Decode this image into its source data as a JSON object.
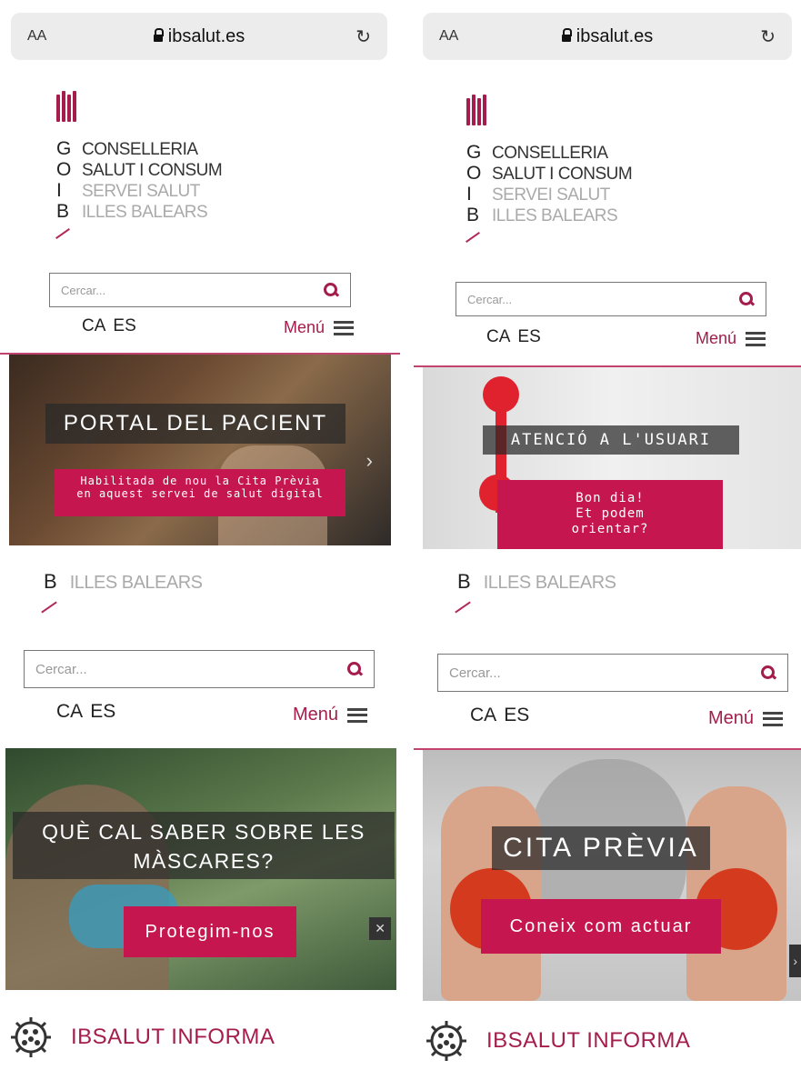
{
  "browser": {
    "aa_label": "AA",
    "host": "ibsalut.es",
    "reload_icon": "reload-icon"
  },
  "logo": {
    "letters": [
      "G",
      "O",
      "I",
      "B"
    ],
    "lines": [
      "CONSELLERIA",
      "SALUT I CONSUM",
      "SERVEI SALUT",
      "ILLES BALEARS"
    ],
    "accent": "#a41d4c"
  },
  "search": {
    "placeholder": "Cercar..."
  },
  "lang": {
    "ca": "CA",
    "es": "ES"
  },
  "menu": {
    "label": "Menú"
  },
  "partial_logo": {
    "letter": "B",
    "text": "ILLES BALEARS"
  },
  "slides": [
    {
      "title": "PORTAL DEL PACIENT",
      "subtitle_1": "Habilitada de nou la Cita Prèvia",
      "subtitle_2": "en aquest servei de salut digital"
    },
    {
      "title": "ATENCIÓ A L'USUARI",
      "subtitle_1": "Bon dia!",
      "subtitle_2": "Et podem",
      "subtitle_3": "orientar?"
    },
    {
      "title_1": "QUÈ CAL SABER SOBRE LES",
      "title_2": "MÀSCARES?",
      "subtitle": "Protegim-nos"
    },
    {
      "title": "CITA PRÈVIA",
      "subtitle": "Coneix com actuar"
    }
  ],
  "informa": {
    "label": "IBSALUT INFORMA"
  },
  "colors": {
    "brand": "#a41d4c",
    "button": "#c5164f"
  }
}
